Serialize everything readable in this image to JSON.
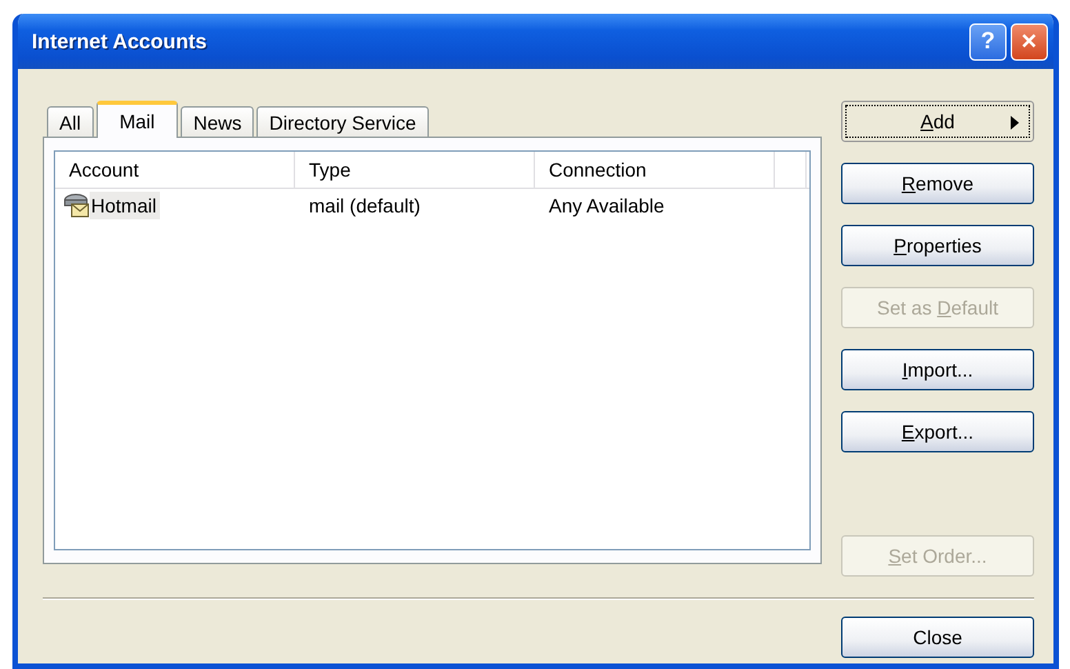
{
  "window": {
    "title": "Internet Accounts",
    "title_buttons": [
      {
        "kind": "help",
        "label": "?"
      },
      {
        "kind": "close",
        "label": "✕"
      }
    ]
  },
  "tabs": [
    {
      "label": "All",
      "selected": false
    },
    {
      "label": "Mail",
      "selected": true
    },
    {
      "label": "News",
      "selected": false
    },
    {
      "label": "Directory Service",
      "selected": false
    }
  ],
  "table": {
    "columns": [
      "Account",
      "Type",
      "Connection"
    ],
    "rows": [
      {
        "account": "Hotmail",
        "type": "mail (default)",
        "connection": "Any Available",
        "selected": false
      }
    ]
  },
  "buttons": [
    {
      "access_key": "A",
      "label_rest": "dd",
      "disabled": false,
      "focused": true,
      "menu": true
    },
    {
      "access_key": "R",
      "label_rest": "emove",
      "disabled": false,
      "focused": false,
      "menu": false
    },
    {
      "access_key": "P",
      "label_rest": "roperties",
      "disabled": false,
      "focused": false,
      "menu": false
    },
    {
      "label_start": "Set as ",
      "access_key": "D",
      "label_rest": "efault",
      "disabled": true,
      "focused": false,
      "menu": false
    },
    {
      "access_key": "I",
      "label_rest": "mport...",
      "disabled": false,
      "focused": false,
      "menu": false
    },
    {
      "access_key": "E",
      "label_rest": "xport...",
      "disabled": false,
      "focused": false,
      "menu": false
    }
  ],
  "bottom_buttons": [
    {
      "access_key": "S",
      "label_rest": "et Order...",
      "disabled": true,
      "focused": false,
      "menu": false
    }
  ],
  "close_button": {
    "label": "Close"
  }
}
